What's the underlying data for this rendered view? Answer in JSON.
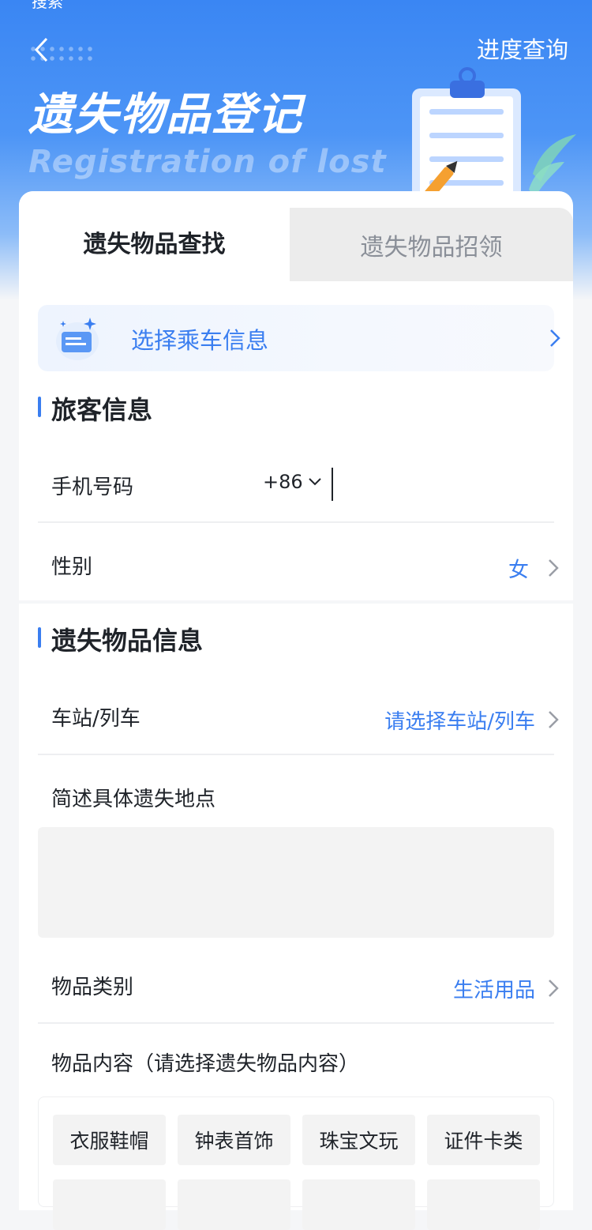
{
  "status_partial": "搜索",
  "header": {
    "back_icon": "chevron-left-icon",
    "progress_link": "进度查询",
    "title": "遗失物品登记",
    "subtitle": "Registration of lost"
  },
  "tabs": [
    {
      "label": "遗失物品查找",
      "active": true
    },
    {
      "label": "遗失物品招领",
      "active": false
    }
  ],
  "ticket": {
    "label": "选择乘车信息"
  },
  "passenger_section": {
    "title": "旅客信息",
    "phone": {
      "label": "手机号码",
      "country_code": "+86",
      "value": ""
    },
    "gender": {
      "label": "性别",
      "value": "女"
    }
  },
  "item_section": {
    "title": "遗失物品信息",
    "station": {
      "label": "车站/列车",
      "placeholder": "请选择车站/列车"
    },
    "location": {
      "label": "简述具体遗失地点",
      "value": ""
    },
    "category": {
      "label": "物品类别",
      "value": "生活用品"
    },
    "content": {
      "label": "物品内容（请选择遗失物品内容）"
    },
    "tags": [
      "衣服鞋帽",
      "钟表首饰",
      "珠宝文玩",
      "证件卡类",
      "",
      "",
      "",
      ""
    ]
  },
  "colors": {
    "accent": "#3a7ef0",
    "hero": "#4d95f6",
    "tag_bg": "#f3f3f3"
  }
}
